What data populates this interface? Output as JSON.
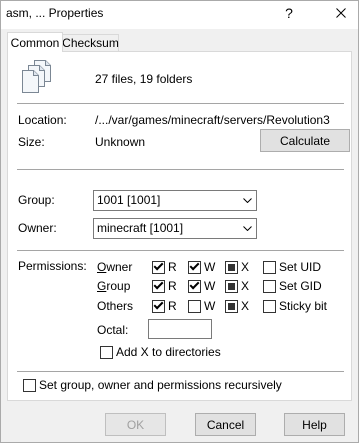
{
  "window": {
    "title": "asm, ... Properties",
    "help_glyph": "?",
    "close_icon": "close-icon"
  },
  "tabs": [
    {
      "label": "Common",
      "active": true
    },
    {
      "label": "Checksum",
      "active": false
    }
  ],
  "summary": {
    "icon": "multiple-files-icon",
    "text": "27 files, 19 folders"
  },
  "location": {
    "label": "Location:",
    "value": "/.../var/games/minecraft/servers/Revolution3"
  },
  "size": {
    "label": "Size:",
    "value": "Unknown",
    "calculate_button": "Calculate"
  },
  "group": {
    "label": "Group:",
    "value": "1001 [1001]",
    "dropdown_icon": "chevron-down-icon"
  },
  "owner": {
    "label": "Owner:",
    "value": "minecraft [1001]",
    "dropdown_icon": "chevron-down-icon"
  },
  "permissions": {
    "label": "Permissions:",
    "bits": {
      "read": "R",
      "write": "W",
      "execute": "X"
    },
    "rows": [
      {
        "label": "Owner",
        "read": "checked",
        "write": "checked",
        "execute": "mixed",
        "special": {
          "label": "Set UID",
          "state": "unchecked"
        }
      },
      {
        "label": "Group",
        "read": "checked",
        "write": "checked",
        "execute": "mixed",
        "special": {
          "label": "Set GID",
          "state": "unchecked"
        }
      },
      {
        "label": "Others",
        "read": "checked",
        "write": "unchecked",
        "execute": "mixed",
        "special": {
          "label": "Sticky bit",
          "state": "unchecked"
        }
      }
    ],
    "octal": {
      "label": "Octal:",
      "value": ""
    },
    "add_x_to_directories": {
      "label": "Add X to directories",
      "state": "unchecked"
    }
  },
  "recursive": {
    "label": "Set group, owner and permissions recursively",
    "state": "unchecked"
  },
  "buttons": {
    "ok": {
      "label": "OK",
      "enabled": false
    },
    "cancel": {
      "label": "Cancel",
      "enabled": true
    },
    "help": {
      "label": "Help",
      "enabled": true
    }
  },
  "colors": {
    "dialog_bg": "#f0f0f0",
    "panel_bg": "#ffffff",
    "button_bg": "#e1e1e1",
    "disabled_text": "#a0a0a0"
  }
}
